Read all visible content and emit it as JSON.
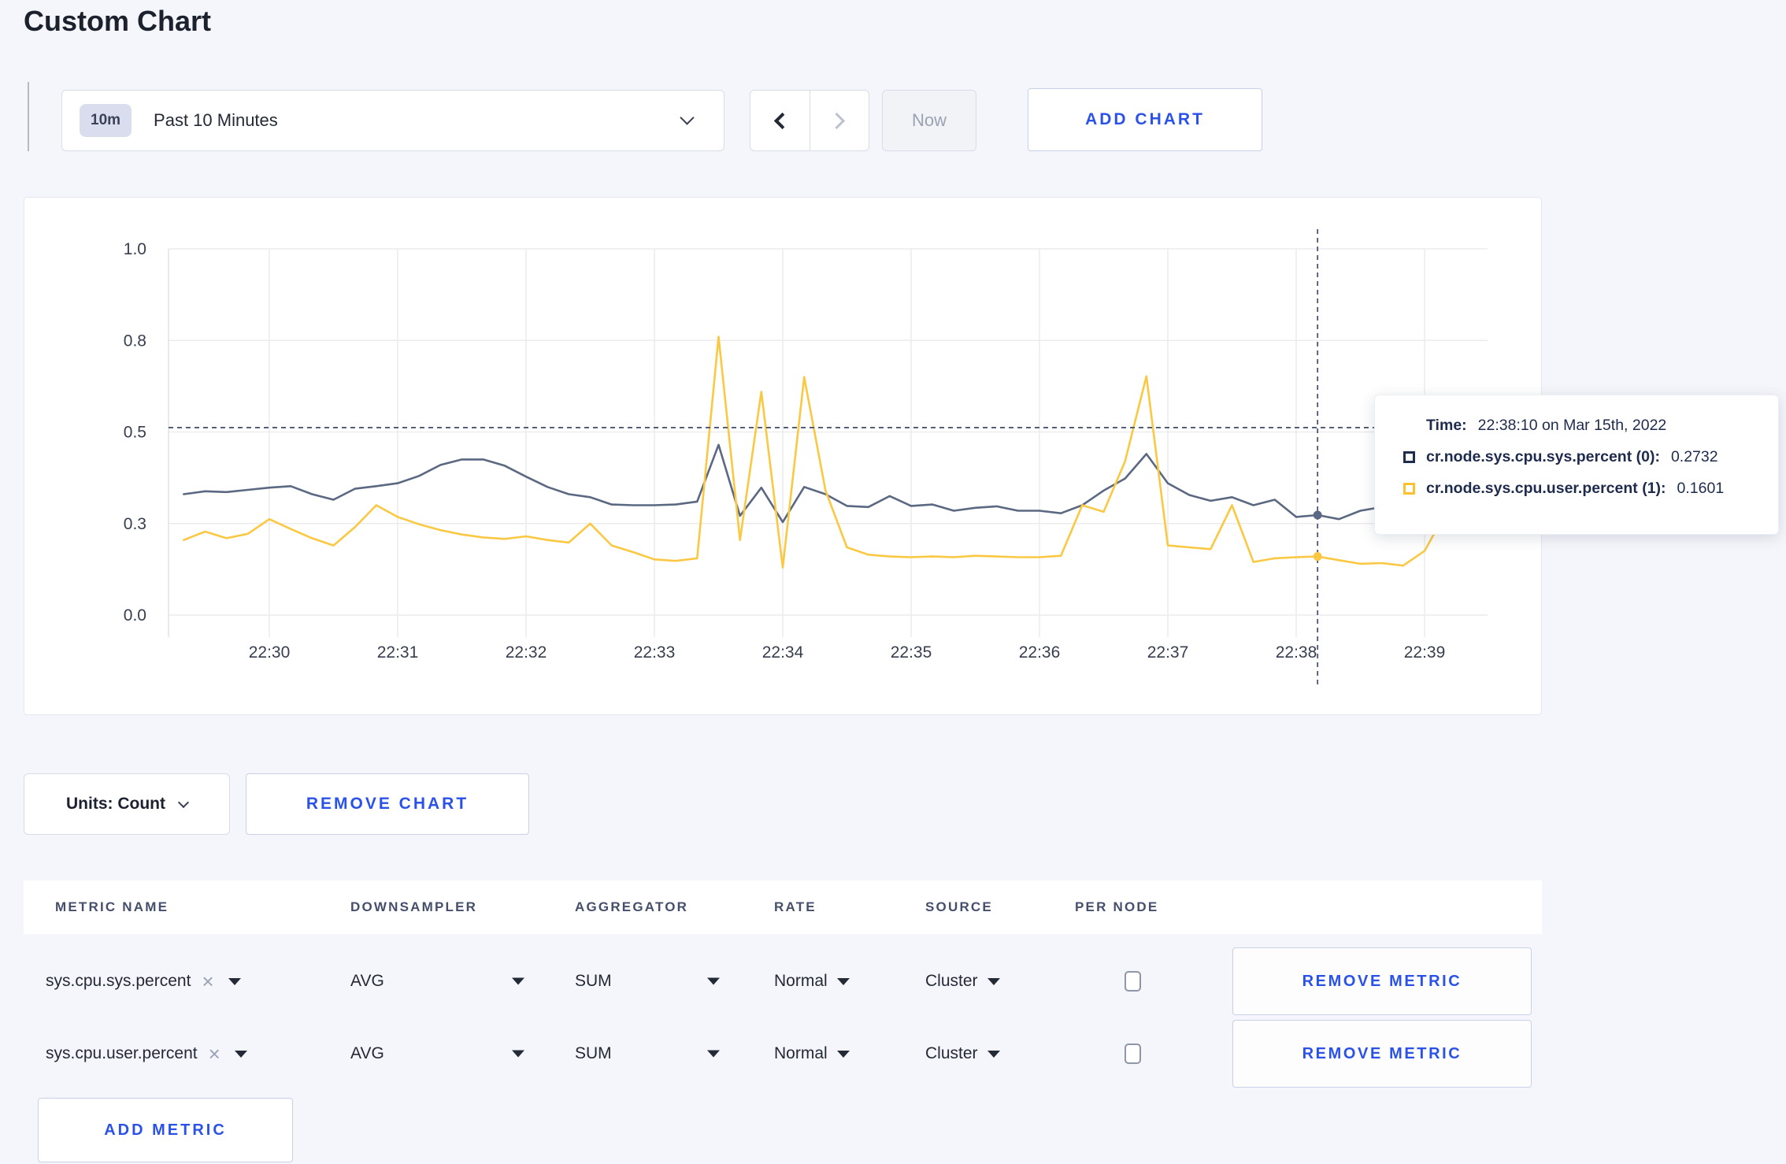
{
  "page": {
    "title": "Custom Chart"
  },
  "toolbar": {
    "time_range_badge": "10m",
    "time_range_label": "Past 10 Minutes",
    "now_label": "Now",
    "add_chart_label": "ADD CHART"
  },
  "chart_data": {
    "type": "line",
    "ylim": [
      0,
      1
    ],
    "yticks": [
      {
        "value": 1.0,
        "label": "1.0"
      },
      {
        "value": 0.75,
        "label": "0.8"
      },
      {
        "value": 0.5,
        "label": "0.5"
      },
      {
        "value": 0.25,
        "label": "0.3"
      },
      {
        "value": 0.0,
        "label": "0.0"
      }
    ],
    "xticks": [
      "22:30",
      "22:31",
      "22:32",
      "22:33",
      "22:34",
      "22:35",
      "22:36",
      "22:37",
      "22:38",
      "22:39"
    ],
    "interval_seconds": 10,
    "start_time": "22:29:20",
    "points_before_first_tick": 4,
    "grid": true,
    "legend_position": "none",
    "series": [
      {
        "name": "cr.node.sys.cpu.sys.percent (0)",
        "color": "#5b6882",
        "values": [
          0.33,
          0.338,
          0.336,
          0.342,
          0.348,
          0.352,
          0.33,
          0.315,
          0.345,
          0.352,
          0.36,
          0.38,
          0.41,
          0.425,
          0.425,
          0.408,
          0.378,
          0.35,
          0.33,
          0.322,
          0.302,
          0.3,
          0.3,
          0.302,
          0.31,
          0.465,
          0.271,
          0.348,
          0.254,
          0.35,
          0.33,
          0.298,
          0.295,
          0.325,
          0.298,
          0.302,
          0.285,
          0.293,
          0.297,
          0.285,
          0.285,
          0.278,
          0.3,
          0.34,
          0.373,
          0.44,
          0.36,
          0.328,
          0.312,
          0.322,
          0.3,
          0.315,
          0.268,
          0.2732,
          0.262,
          0.285,
          0.295,
          0.3,
          0.298,
          0.298,
          0.3
        ]
      },
      {
        "name": "cr.node.sys.cpu.user.percent (1)",
        "color": "#fac842",
        "values": [
          0.205,
          0.228,
          0.21,
          0.222,
          0.262,
          0.235,
          0.21,
          0.19,
          0.24,
          0.3,
          0.268,
          0.248,
          0.232,
          0.22,
          0.212,
          0.208,
          0.215,
          0.205,
          0.198,
          0.25,
          0.19,
          0.172,
          0.152,
          0.148,
          0.155,
          0.76,
          0.205,
          0.61,
          0.13,
          0.65,
          0.34,
          0.185,
          0.165,
          0.16,
          0.158,
          0.16,
          0.158,
          0.162,
          0.16,
          0.158,
          0.158,
          0.162,
          0.3,
          0.282,
          0.42,
          0.652,
          0.19,
          0.185,
          0.18,
          0.3,
          0.145,
          0.155,
          0.158,
          0.1601,
          0.15,
          0.14,
          0.142,
          0.135,
          0.175,
          0.28,
          0.245
        ]
      }
    ],
    "crosshair": {
      "index": 53,
      "time": "22:38:10",
      "hline_value": 0.512
    }
  },
  "tooltip": {
    "time_label": "Time:",
    "time_value": "22:38:10 on Mar 15th, 2022",
    "rows": [
      {
        "name": "cr.node.sys.cpu.sys.percent (0):",
        "value": "0.2732",
        "color": "#1e2c4e"
      },
      {
        "name": "cr.node.sys.cpu.user.percent (1):",
        "value": "0.1601",
        "color": "#fdc02f"
      }
    ]
  },
  "units_bar": {
    "units_label": "Units: Count",
    "remove_chart_label": "REMOVE CHART"
  },
  "table": {
    "headers": [
      "METRIC NAME",
      "DOWNSAMPLER",
      "AGGREGATOR",
      "RATE",
      "SOURCE",
      "PER NODE"
    ],
    "rows": [
      {
        "metric": "sys.cpu.sys.percent",
        "downsampler": "AVG",
        "aggregator": "SUM",
        "rate": "Normal",
        "source": "Cluster",
        "per_node_checked": false,
        "remove_label": "REMOVE METRIC"
      },
      {
        "metric": "sys.cpu.user.percent",
        "downsampler": "AVG",
        "aggregator": "SUM",
        "rate": "Normal",
        "source": "Cluster",
        "per_node_checked": false,
        "remove_label": "REMOVE METRIC"
      }
    ],
    "add_metric_label": "ADD METRIC"
  },
  "colors": {
    "accent_blue": "#2b52e8",
    "page_background": "#f5f6fb",
    "panel_background": "#ffffff"
  }
}
